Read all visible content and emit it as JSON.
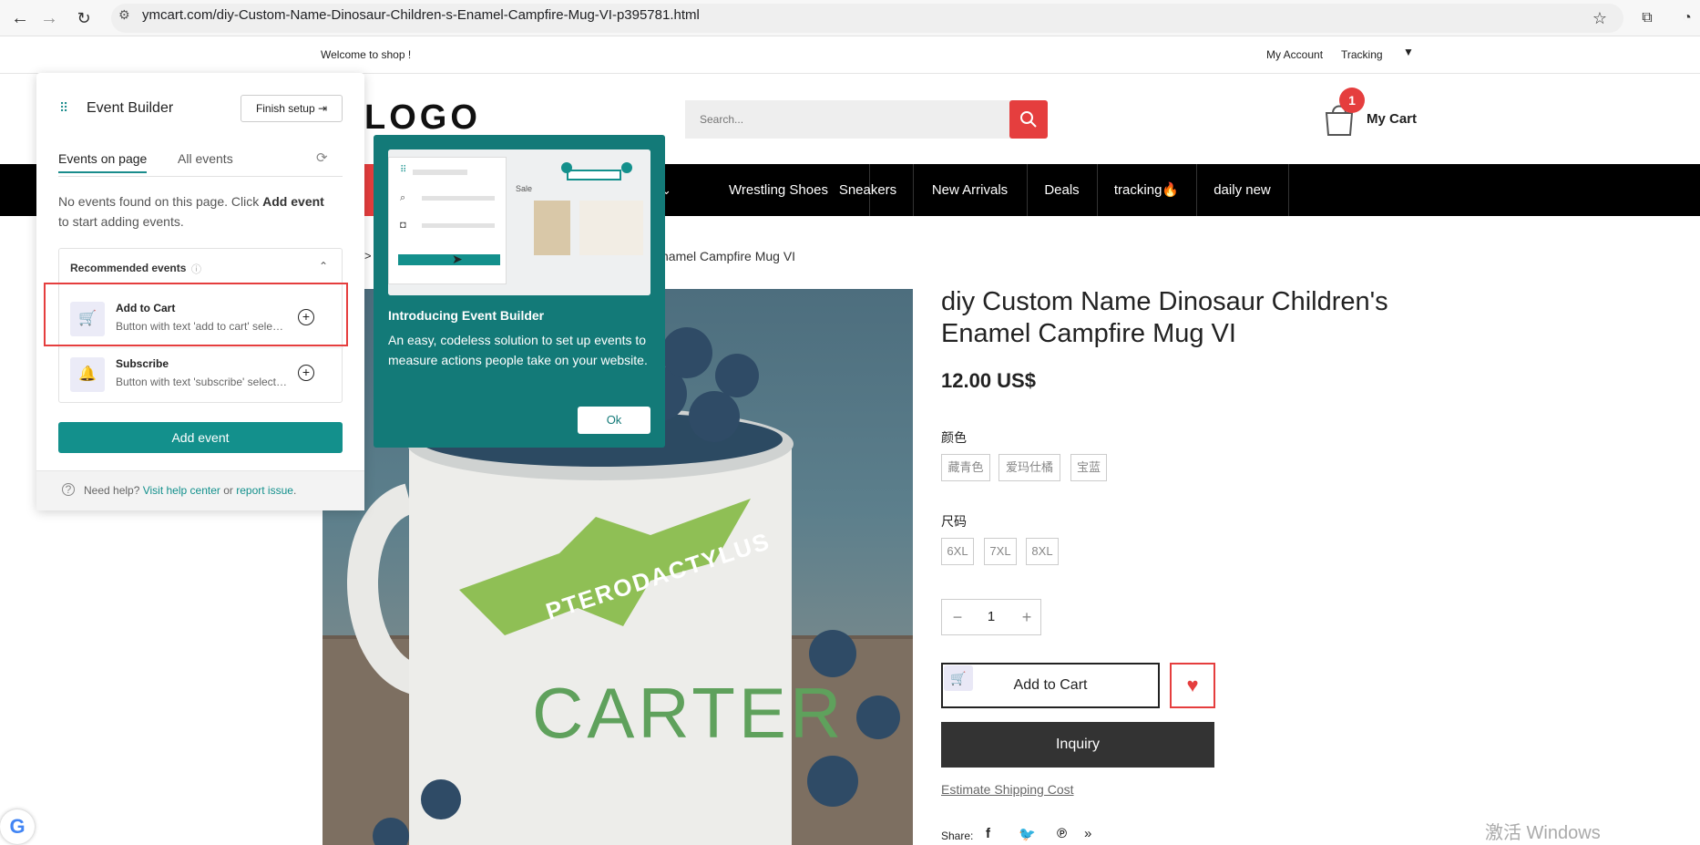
{
  "browser": {
    "url": "ymcart.com/diy-Custom-Name-Dinosaur-Children-s-Enamel-Campfire-Mug-VI-p395781.html"
  },
  "topbar": {
    "welcome": "Welcome to shop !",
    "my_account": "My Account",
    "tracking": "Tracking"
  },
  "header": {
    "logo": "LOGO",
    "search_placeholder": "Search...",
    "cart_count": "1",
    "cart_label": "My Cart"
  },
  "nav": {
    "items": [
      "Wrestling Shoes",
      "Sneakers",
      "New Arrivals",
      "Deals",
      "tracking🔥",
      "daily new"
    ]
  },
  "breadcrumb": {
    "sep": ">",
    "current": "namel Campfire Mug VI"
  },
  "product": {
    "title": "diy Custom Name Dinosaur Children's Enamel Campfire Mug VI",
    "price": "12.00 US$",
    "color_label": "颜色",
    "colors": [
      "藏青色",
      "爱玛仕橘",
      "宝蓝"
    ],
    "size_label": "尺码",
    "sizes": [
      "6XL",
      "7XL",
      "8XL"
    ],
    "qty": "1",
    "qty_minus": "−",
    "qty_plus": "+",
    "add_to_cart": "Add to Cart",
    "inquiry": "Inquiry",
    "estimate_shipping": "Estimate Shipping Cost",
    "share_label": "Share:",
    "mug_word_top": "PTERODACTYLUS",
    "mug_word_name": "CARTER"
  },
  "event_builder": {
    "title": "Event Builder",
    "finish_setup": "Finish setup",
    "tab_on_page": "Events on page",
    "tab_all": "All events",
    "no_events_prefix": "No events found on this page. Click ",
    "no_events_bold": "Add event",
    "no_events_suffix": " to start adding events.",
    "recommended_title": "Recommended events",
    "items": [
      {
        "name": "Add to Cart",
        "desc": "Button with text 'add to cart' selected"
      },
      {
        "name": "Subscribe",
        "desc": "Button with text 'subscribe' selected"
      }
    ],
    "add_event": "Add event",
    "help_prefix": "Need help? ",
    "help_link": "Visit help center",
    "help_or": " or ",
    "report_link": "report issue",
    "help_end": "."
  },
  "intro_popup": {
    "preview_sale": "Sale",
    "title": "Introducing Event Builder",
    "body": "An easy, codeless solution to set up events to measure actions people take on your website.",
    "ok": "Ok"
  },
  "watermark": "激活 Windows",
  "colors": {
    "accent_teal": "#13908c",
    "accent_red": "#e53e3e"
  }
}
